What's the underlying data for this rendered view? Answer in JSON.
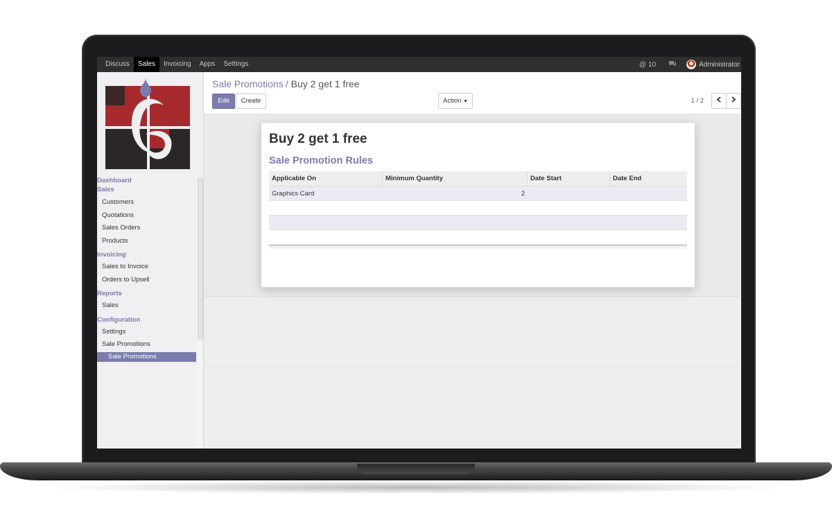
{
  "topbar": {
    "menu": [
      {
        "label": "Discuss",
        "active": false
      },
      {
        "label": "Sales",
        "active": true
      },
      {
        "label": "Invoicing",
        "active": false
      },
      {
        "label": "Apps",
        "active": false
      },
      {
        "label": "Settings",
        "active": false
      }
    ],
    "notification_count": "10",
    "notification_icon": "at-sign-icon",
    "chat_icon": "chat-bubbles-icon",
    "user_name": "Administrator"
  },
  "sidebar": {
    "logo_colors": {
      "red": "#a62a2d",
      "dark": "#2b2727",
      "drop": "#7c7bad"
    },
    "sections": [
      {
        "label": "Dashboard",
        "items": []
      },
      {
        "label": "Sales",
        "items": [
          "Customers",
          "Quotations",
          "Sales Orders",
          "Products"
        ]
      },
      {
        "label": "Invoicing",
        "items": [
          "Sales to Invoice",
          "Orders to Upsell"
        ]
      },
      {
        "label": "Reports",
        "items": [
          "Sales"
        ]
      },
      {
        "label": "Configuration",
        "items": [
          "Settings",
          "Sale Promotions"
        ]
      }
    ],
    "active_item": "Sale Promotions"
  },
  "control": {
    "breadcrumb_parent": "Sale Promotions",
    "breadcrumb_separator": "/",
    "breadcrumb_current": "Buy 2 get 1 free",
    "edit_label": "Edit",
    "create_label": "Create",
    "action_label": "Action",
    "pager": "1 / 2",
    "prev_icon": "chevron-left-icon",
    "next_icon": "chevron-right-icon"
  },
  "form": {
    "title": "Buy 2 get 1 free",
    "section_title": "Sale Promotion Rules",
    "columns": [
      "Applicable On",
      "Minimum Quantity",
      "Date Start",
      "Date End"
    ],
    "rows": [
      {
        "applicable_on": "Graphics Card",
        "min_qty": "2",
        "date_start": "",
        "date_end": ""
      }
    ]
  },
  "colors": {
    "accent": "#7c7bad",
    "topbar": "#2f2f2f",
    "background": "#efeeef"
  }
}
